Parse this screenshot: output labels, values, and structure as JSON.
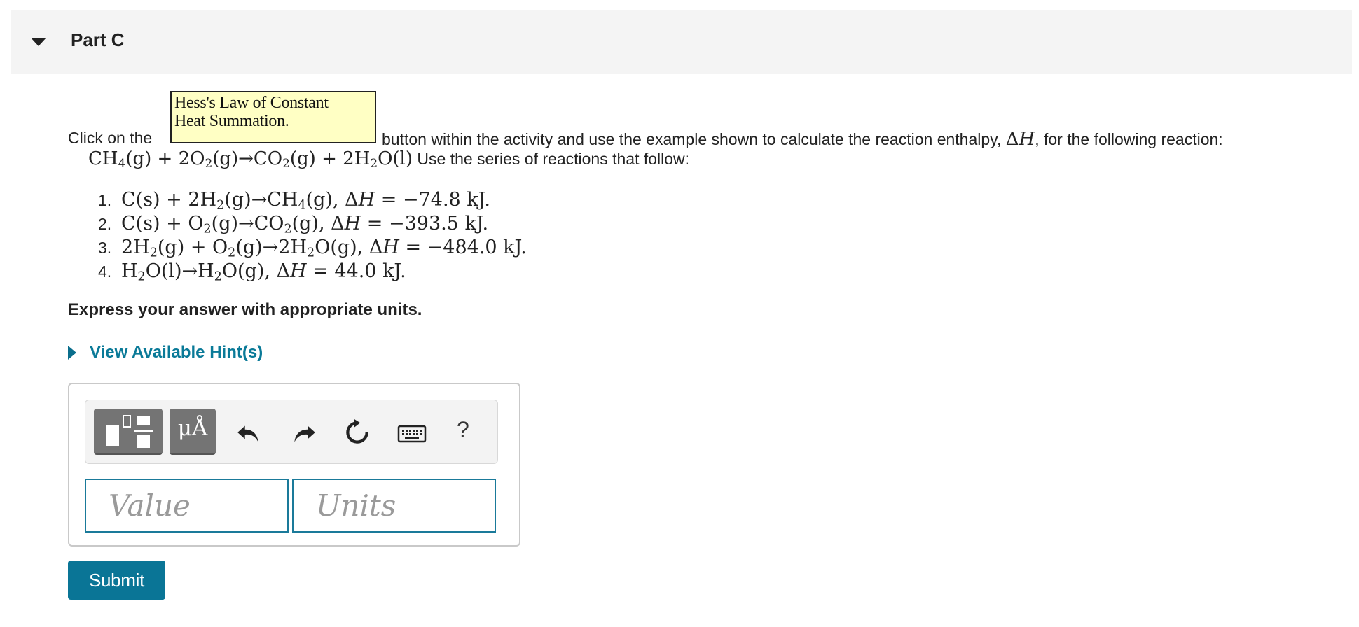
{
  "part": {
    "title": "Part C"
  },
  "intro": {
    "prefix": "Click on the",
    "button_line1": "Hess's Law of Constant",
    "button_line2": "Heat Summation.",
    "suffix": "button within the activity and use the example shown to calculate the reaction enthalpy,",
    "delta_h": "ΔH",
    "suffix2": ", for the following reaction:"
  },
  "reaction": {
    "equation": "CH4(g) + 2O2(g)→CO2(g) + 2H2O(l)",
    "follow_text": "Use the series of reactions that follow:"
  },
  "steps": [
    {
      "num": "1.",
      "equation": "C(s) + 2H2(g)→CH4(g), ΔH = −74.8 kJ."
    },
    {
      "num": "2.",
      "equation": "C(s) + O2(g)→CO2(g), ΔH = −393.5 kJ."
    },
    {
      "num": "3.",
      "equation": "2H2(g) + O2(g)→2H2O(g), ΔH = −484.0 kJ."
    },
    {
      "num": "4.",
      "equation": "H2O(l)→H2O(g), ΔH = 44.0 kJ."
    }
  ],
  "instructions": "Express your answer with appropriate units.",
  "hints": {
    "label": "View Available Hint(s)"
  },
  "toolbar": {
    "templates_icon": "templates-icon",
    "units_label": "μÅ",
    "undo_icon": "undo-icon",
    "redo_icon": "redo-icon",
    "reset_icon": "reset-icon",
    "keyboard_icon": "keyboard-icon",
    "help_label": "?"
  },
  "answer": {
    "value_placeholder": "Value",
    "units_placeholder": "Units"
  },
  "submit": {
    "label": "Submit"
  },
  "colors": {
    "accent": "#0a7596",
    "hint": "#0a7a98",
    "hess_bg": "#ffffc4"
  }
}
